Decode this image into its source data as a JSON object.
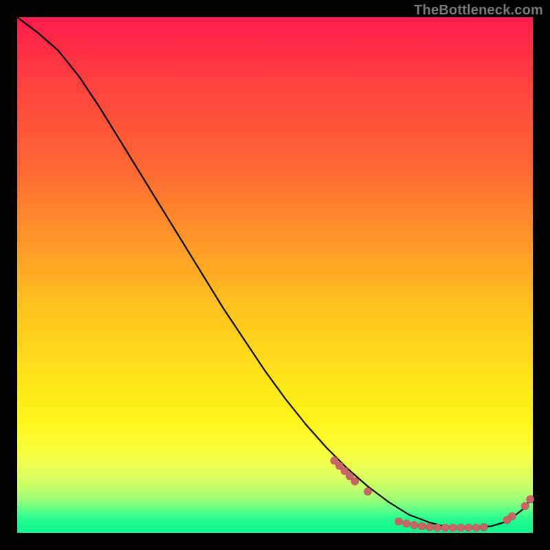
{
  "watermark": "TheBottleneck.com",
  "colors": {
    "line": "#000000",
    "dot_fill": "#c76666",
    "dot_stroke": "#b94f4f"
  },
  "chart_data": {
    "type": "line",
    "title": "",
    "xlabel": "",
    "ylabel": "",
    "xlim": [
      0,
      100
    ],
    "ylim": [
      0,
      100
    ],
    "series": [
      {
        "name": "bottleneck-curve",
        "x": [
          0,
          4,
          8,
          12,
          16,
          20,
          24,
          28,
          32,
          36,
          40,
          44,
          48,
          52,
          56,
          60,
          64,
          68,
          72,
          76,
          80,
          83,
          86,
          89,
          92,
          95,
          98,
          100
        ],
        "y": [
          100,
          97,
          93.5,
          88.5,
          82.5,
          76,
          69.5,
          63,
          56.5,
          50,
          43.5,
          37.5,
          31.5,
          26,
          21,
          16.5,
          12.5,
          9,
          6,
          3.5,
          2,
          1.2,
          1,
          1,
          1.3,
          2.2,
          4.5,
          7
        ]
      }
    ],
    "dot_clusters": [
      {
        "name": "descent-cluster",
        "points": [
          {
            "x": 61.5,
            "y": 14.0
          },
          {
            "x": 62.5,
            "y": 13.0
          },
          {
            "x": 63.5,
            "y": 12.0
          },
          {
            "x": 64.5,
            "y": 11.0
          },
          {
            "x": 65.5,
            "y": 10.0
          },
          {
            "x": 68.0,
            "y": 8.0
          }
        ]
      },
      {
        "name": "valley-cluster",
        "points": [
          {
            "x": 74.0,
            "y": 2.2
          },
          {
            "x": 75.5,
            "y": 1.8
          },
          {
            "x": 77.0,
            "y": 1.5
          },
          {
            "x": 78.5,
            "y": 1.3
          },
          {
            "x": 80.0,
            "y": 1.1
          },
          {
            "x": 81.5,
            "y": 1.0
          },
          {
            "x": 83.0,
            "y": 1.0
          },
          {
            "x": 84.5,
            "y": 1.0
          },
          {
            "x": 86.0,
            "y": 1.0
          },
          {
            "x": 87.5,
            "y": 1.0
          },
          {
            "x": 89.0,
            "y": 1.0
          },
          {
            "x": 90.5,
            "y": 1.1
          }
        ]
      },
      {
        "name": "rise-cluster",
        "points": [
          {
            "x": 95.0,
            "y": 2.5
          },
          {
            "x": 96.0,
            "y": 3.2
          },
          {
            "x": 98.5,
            "y": 5.2
          },
          {
            "x": 99.5,
            "y": 6.5
          }
        ]
      }
    ]
  }
}
